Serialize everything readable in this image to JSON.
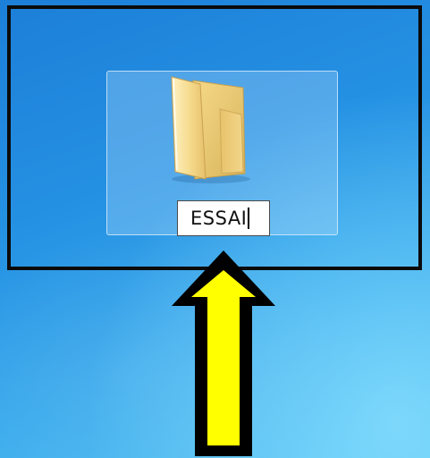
{
  "desktop": {
    "background_color": "#2591e3"
  },
  "highlight": {
    "border_color": "#0b0b0b"
  },
  "folder_item": {
    "icon": "folder-icon",
    "rename_value": "ESSAI"
  },
  "annotation": {
    "arrow_fill": "#ffff00",
    "arrow_outline": "#000000"
  }
}
